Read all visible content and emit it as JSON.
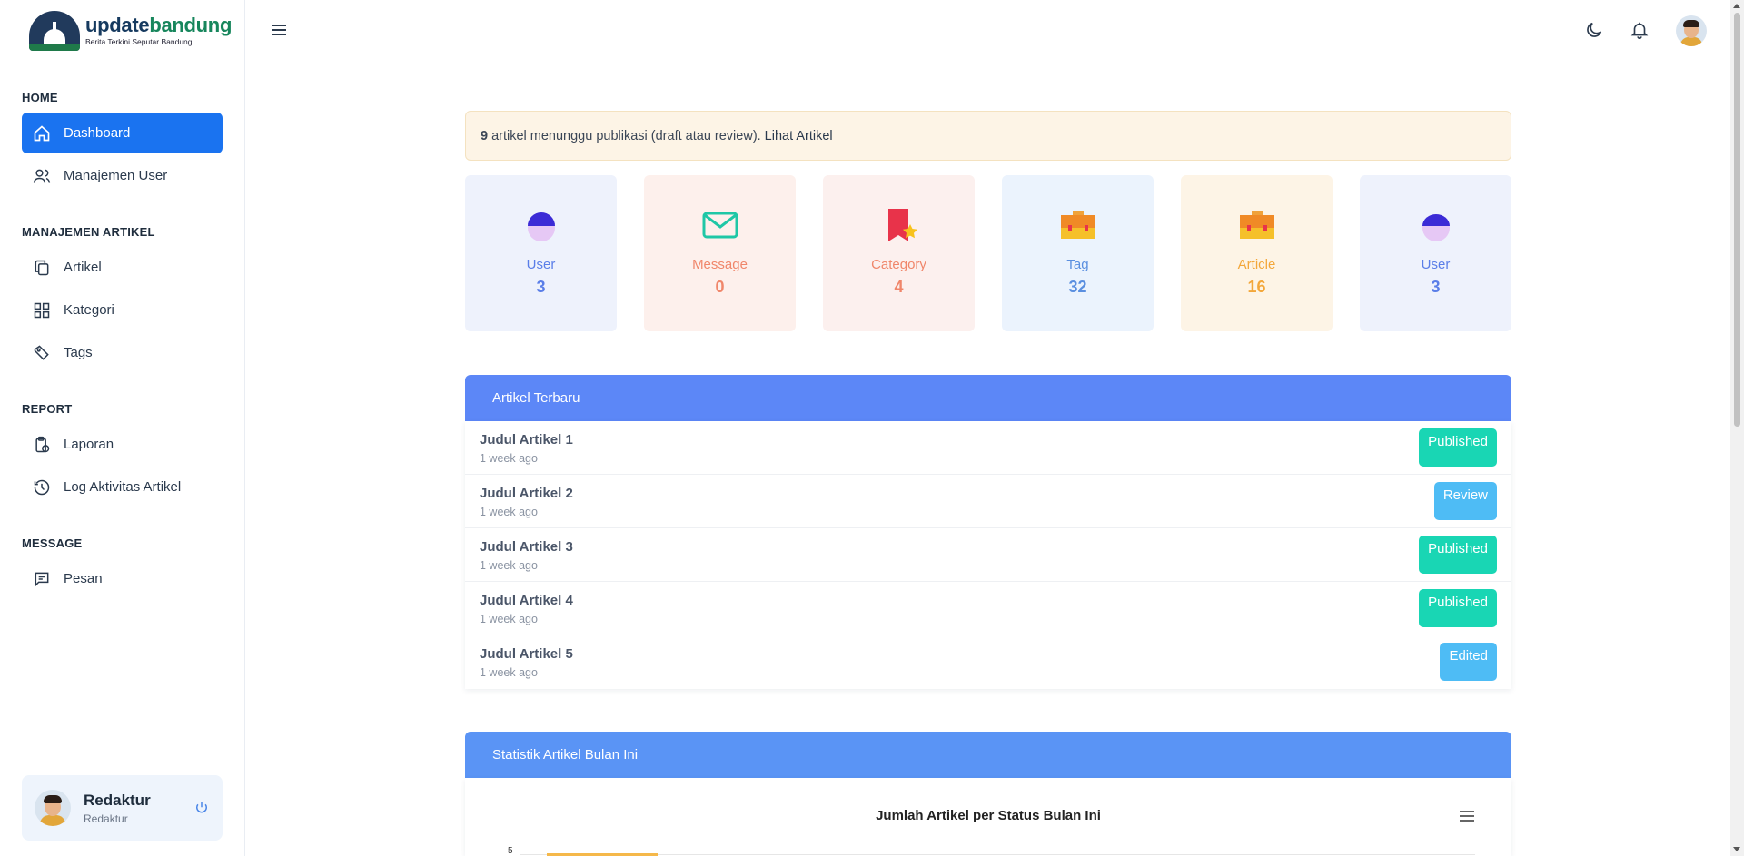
{
  "brand": {
    "name_part1": "update",
    "name_part2": "bandung",
    "tagline": "Berita Terkini Seputar Bandung"
  },
  "sidebar": {
    "sections": [
      {
        "title": "HOME"
      },
      {
        "title": "MANAJEMEN ARTIKEL"
      },
      {
        "title": "REPORT"
      },
      {
        "title": "MESSAGE"
      }
    ],
    "items": [
      {
        "label": "Dashboard",
        "icon": "home-icon",
        "active": true
      },
      {
        "label": "Manajemen User",
        "icon": "users-icon"
      },
      {
        "label": "Artikel",
        "icon": "copy-icon"
      },
      {
        "label": "Kategori",
        "icon": "grid-icon"
      },
      {
        "label": "Tags",
        "icon": "tags-icon"
      },
      {
        "label": "Laporan",
        "icon": "clipboard-icon"
      },
      {
        "label": "Log Aktivitas Artikel",
        "icon": "history-icon"
      },
      {
        "label": "Pesan",
        "icon": "message-icon"
      }
    ]
  },
  "profile": {
    "name": "Redaktur",
    "role": "Redaktur"
  },
  "alert": {
    "count": "9",
    "text": "artikel menunggu publikasi (draft atau review).",
    "link": "Lihat Artikel"
  },
  "stats": [
    {
      "label": "User",
      "value": "3",
      "icon": "user-icon",
      "color": "#5a7ee8",
      "bg": "#eef2fc"
    },
    {
      "label": "Message",
      "value": "0",
      "icon": "mail-icon",
      "color": "#f0866a",
      "bg": "#fdf0ec"
    },
    {
      "label": "Category",
      "value": "4",
      "icon": "bookmark-star-icon",
      "color": "#f0866a",
      "bg": "#fcf0ee"
    },
    {
      "label": "Tag",
      "value": "32",
      "icon": "briefcase-icon",
      "color": "#5a8fe0",
      "bg": "#ebf3fd"
    },
    {
      "label": "Article",
      "value": "16",
      "icon": "briefcase-icon",
      "color": "#f3a73a",
      "bg": "#fdf4e6"
    },
    {
      "label": "User",
      "value": "3",
      "icon": "user-icon",
      "color": "#5a7ee8",
      "bg": "#eef2fc"
    }
  ],
  "latest_articles": {
    "title": "Artikel Terbaru",
    "header_color": "#5c87f7",
    "rows": [
      {
        "title": "Judul Artikel 1",
        "time": "1 week ago",
        "status": "Published",
        "status_color": "#19d6b4"
      },
      {
        "title": "Judul Artikel 2",
        "time": "1 week ago",
        "status": "Review",
        "status_color": "#4ebcf5"
      },
      {
        "title": "Judul Artikel 3",
        "time": "1 week ago",
        "status": "Published",
        "status_color": "#19d6b4"
      },
      {
        "title": "Judul Artikel 4",
        "time": "1 week ago",
        "status": "Published",
        "status_color": "#19d6b4"
      },
      {
        "title": "Judul Artikel 5",
        "time": "1 week ago",
        "status": "Edited",
        "status_color": "#4ebcf5"
      }
    ]
  },
  "stats_panel": {
    "title": "Statistik Artikel Bulan Ini",
    "header_color": "#5a94f5"
  },
  "chart_data": {
    "type": "bar",
    "title": "Jumlah Artikel per Status Bulan Ini",
    "y_ticks": [
      "5"
    ],
    "series": [
      {
        "values": [
          5
        ]
      }
    ],
    "colors": [
      "#f5b84a"
    ]
  },
  "topbar": {
    "icons": [
      "menu-icon",
      "moon-icon",
      "bell-icon"
    ]
  }
}
